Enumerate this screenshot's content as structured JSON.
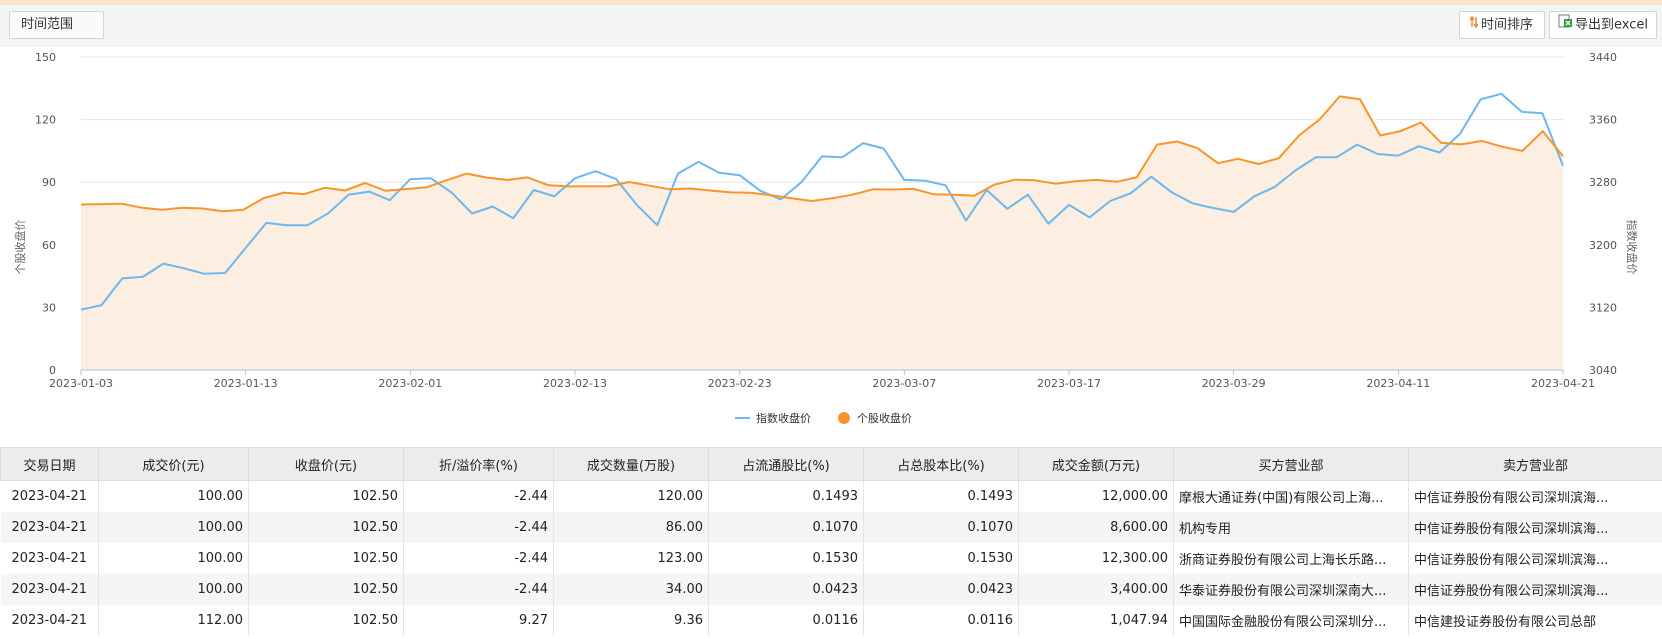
{
  "toolbar": {
    "range_label": "时间范围",
    "sort_label": "时间排序",
    "excel_label": "导出到excel"
  },
  "chart_data": {
    "type": "line",
    "x_labels": [
      "2023-01-03",
      "2023-01-13",
      "2023-02-01",
      "2023-02-13",
      "2023-02-23",
      "2023-03-07",
      "2023-03-17",
      "2023-03-29",
      "2023-04-11",
      "2023-04-21"
    ],
    "ylabel_left": "个股收盘价",
    "ylabel_right": "指数收盘价",
    "ylim_left": [
      0,
      150
    ],
    "yticks_left": [
      0,
      30,
      60,
      90,
      120,
      150
    ],
    "ylim_right": [
      3040,
      3440
    ],
    "yticks_right": [
      3040,
      3120,
      3200,
      3280,
      3360,
      3440
    ],
    "grid": true,
    "legend_position": "bottom",
    "series": [
      {
        "name": "指数收盘价",
        "axis": "right",
        "style": "line",
        "color": "#6cb7ee",
        "values": [
          3117,
          3123,
          3157,
          3159,
          3176,
          3170,
          3163,
          3164,
          3196,
          3228,
          3225,
          3225,
          3240,
          3264,
          3268,
          3257,
          3284,
          3285,
          3267,
          3240,
          3249,
          3234,
          3270,
          3262,
          3285,
          3294,
          3284,
          3251,
          3225,
          3291,
          3306,
          3292,
          3289,
          3269,
          3258,
          3280,
          3313,
          3312,
          3330,
          3323,
          3283,
          3282,
          3276,
          3231,
          3270,
          3246,
          3264,
          3227,
          3251,
          3235,
          3256,
          3266,
          3287,
          3267,
          3253,
          3247,
          3242,
          3262,
          3274,
          3295,
          3312,
          3312,
          3328,
          3316,
          3314,
          3326,
          3318,
          3342,
          3386,
          3393,
          3370,
          3368,
          3301
        ]
      },
      {
        "name": "个股收盘价",
        "axis": "left",
        "style": "area",
        "color": "#f7952b",
        "fill": "#fdeee2",
        "values": [
          79.3,
          79.5,
          79.7,
          77.8,
          76.8,
          77.8,
          77.4,
          76.1,
          76.8,
          82.4,
          85.0,
          84.3,
          87.3,
          86.0,
          89.6,
          85.9,
          86.7,
          87.5,
          90.9,
          94.1,
          92.2,
          91.1,
          92.3,
          88.6,
          88.0,
          88.0,
          88.0,
          90.1,
          88.3,
          86.6,
          87.0,
          86.0,
          85.1,
          84.9,
          83.7,
          82.3,
          81.0,
          82.3,
          84.0,
          86.6,
          86.5,
          86.8,
          84.2,
          84.0,
          83.5,
          88.9,
          91.2,
          90.9,
          89.3,
          90.5,
          91.1,
          90.2,
          92.3,
          108.0,
          109.5,
          106.3,
          99.1,
          101.2,
          98.7,
          101.5,
          112.4,
          120.0,
          131.1,
          129.8,
          112.4,
          114.5,
          118.6,
          108.9,
          108.1,
          109.8,
          107.0,
          105.0,
          114.5,
          102.5
        ]
      }
    ]
  },
  "table": {
    "headers": [
      "交易日期",
      "成交价(元)",
      "收盘价(元)",
      "折/溢价率(%)",
      "成交数量(万股)",
      "占流通股比(%)",
      "占总股本比(%)",
      "成交金额(万元)",
      "买方营业部",
      "卖方营业部"
    ],
    "rows": [
      [
        "2023-04-21",
        "100.00",
        "102.50",
        "-2.44",
        "120.00",
        "0.1493",
        "0.1493",
        "12,000.00",
        "摩根大通证券(中国)有限公司上海...",
        "中信证券股份有限公司深圳滨海..."
      ],
      [
        "2023-04-21",
        "100.00",
        "102.50",
        "-2.44",
        "86.00",
        "0.1070",
        "0.1070",
        "8,600.00",
        "机构专用",
        "中信证券股份有限公司深圳滨海..."
      ],
      [
        "2023-04-21",
        "100.00",
        "102.50",
        "-2.44",
        "123.00",
        "0.1530",
        "0.1530",
        "12,300.00",
        "浙商证券股份有限公司上海长乐路...",
        "中信证券股份有限公司深圳滨海..."
      ],
      [
        "2023-04-21",
        "100.00",
        "102.50",
        "-2.44",
        "34.00",
        "0.0423",
        "0.0423",
        "3,400.00",
        "华泰证券股份有限公司深圳深南大...",
        "中信证券股份有限公司深圳滨海..."
      ],
      [
        "2023-04-21",
        "112.00",
        "102.50",
        "9.27",
        "9.36",
        "0.0116",
        "0.0116",
        "1,047.94",
        "中国国际金融股份有限公司深圳分...",
        "中信建投证券股份有限公司总部"
      ]
    ]
  }
}
